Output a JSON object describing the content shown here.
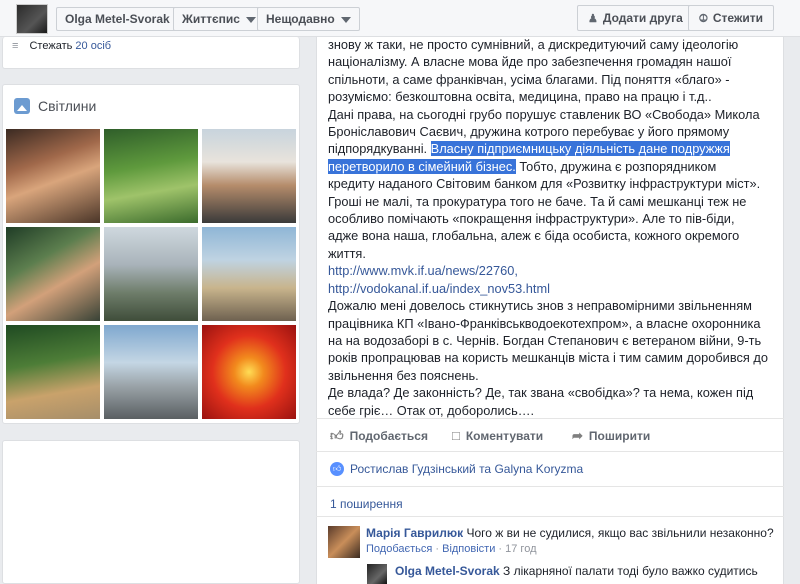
{
  "header": {
    "profile_name": "Olga Metel-Svorak",
    "tab_timeline": "Життєпис",
    "tab_recent": "Нещодавно",
    "add_friend": "Додати друга",
    "follow": "Стежити"
  },
  "sidebar": {
    "followers_prefix": "Стежать",
    "followers_count": "20 осіб",
    "photos_title": "Світлини"
  },
  "post": {
    "lines": [
      "знову ж таки, не просто сумнівний, а дискредитуючий саму ідеологію",
      "націоналізму. А власне мова йде про забезпечення громадян нашої",
      "спільноти, а саме франківчан, усіма благами. Під поняття «благо» -",
      "розуміємо: безкоштовна освіта, медицина, право на працю і т.д..",
      "Дані права, на сьогодні грубо порушує ставленик ВО «Свобода» Микола",
      "Броніславович Саєвич, дружина котрого перебуває у його прямому",
      "підпорядкуванні."
    ],
    "highlight_1": "Власну підприємницьку діяльність дане подружжя",
    "highlight_2": "перетворило в сімейний бізнес.",
    "after_highlight": " Тобто, дружина є розпорядником",
    "lines2": [
      "кредиту наданого Світовим банком для «Розвитку інфраструктури міст».",
      "Гроші не малі, та прокуратура того не баче. Та й самі мешканці теж не",
      "особливо помічають «покращення інфраструктури». Але то пів-біди,",
      "адже вона наша, глобальна, алеж є біда особиста, кожного окремого",
      "життя."
    ],
    "link1": "http://www.mvk.if.ua/news/22760,",
    "link2": "http://vodokanal.if.ua/index_nov53.html",
    "lines3": [
      "Дожалю мені довелось стикнутись знов з неправомірними звільненням",
      "працівника КП «Івано-Франківськводоекотехпром», а власне охоронника",
      "на на водозаборі в с. Чернів. Богдан Степанович є ветераном війни, 9-ть",
      "років пропрацював на користь мешканців міста і тим самим доробився до",
      "звільнення без пояснень.",
      "Де влада? Де законність? Де, так звана «свобідка»? та нема, кожен під",
      "себе гріє… Отак от, доборолись…."
    ]
  },
  "actions": {
    "like": "Подобається",
    "comment": "Коментувати",
    "share": "Поширити"
  },
  "likes_text": "Ростислав Гудзінський та Galyna Koryzma",
  "shares_text": "1 поширення",
  "comment": {
    "author": "Марія Гаврилюк",
    "text": "Чого ж ви не судилися, якщо вас звільнили незаконно?",
    "meta_like": "Подобається",
    "meta_reply": "Відповісти",
    "meta_time": "17 год"
  },
  "reply": {
    "author": "Olga Metel-Svorak",
    "text": "З лікарняної палати тоді було важко судитись"
  },
  "colors": {
    "link": "#365899",
    "highlight": "#3873d9"
  }
}
